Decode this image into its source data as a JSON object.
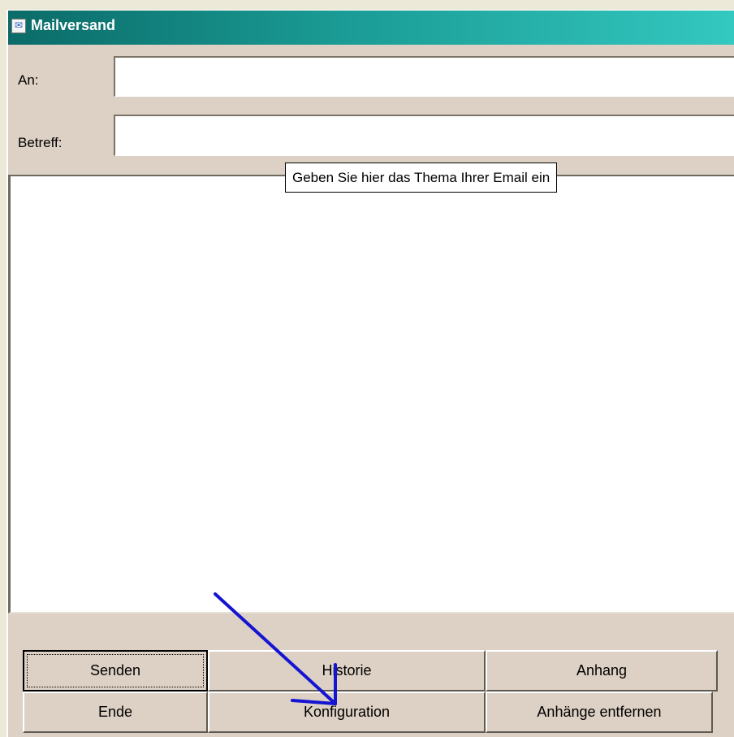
{
  "window": {
    "title": "Mailversand",
    "icon": "mail-app-icon"
  },
  "form": {
    "to_label": "An:",
    "to_value": "",
    "subject_label": "Betreff:",
    "subject_value": "",
    "body_value": ""
  },
  "tooltip": {
    "text": "Geben Sie hier das Thema Ihrer Email ein"
  },
  "buttons": {
    "senden": "Senden",
    "historie": "Historie",
    "anhang": "Anhang",
    "ende": "Ende",
    "konfiguration": "Konfiguration",
    "anhaenge_entfernen": "Anhänge entfernen"
  },
  "annotation": {
    "color": "#1414d2",
    "points_to": "Konfiguration"
  }
}
